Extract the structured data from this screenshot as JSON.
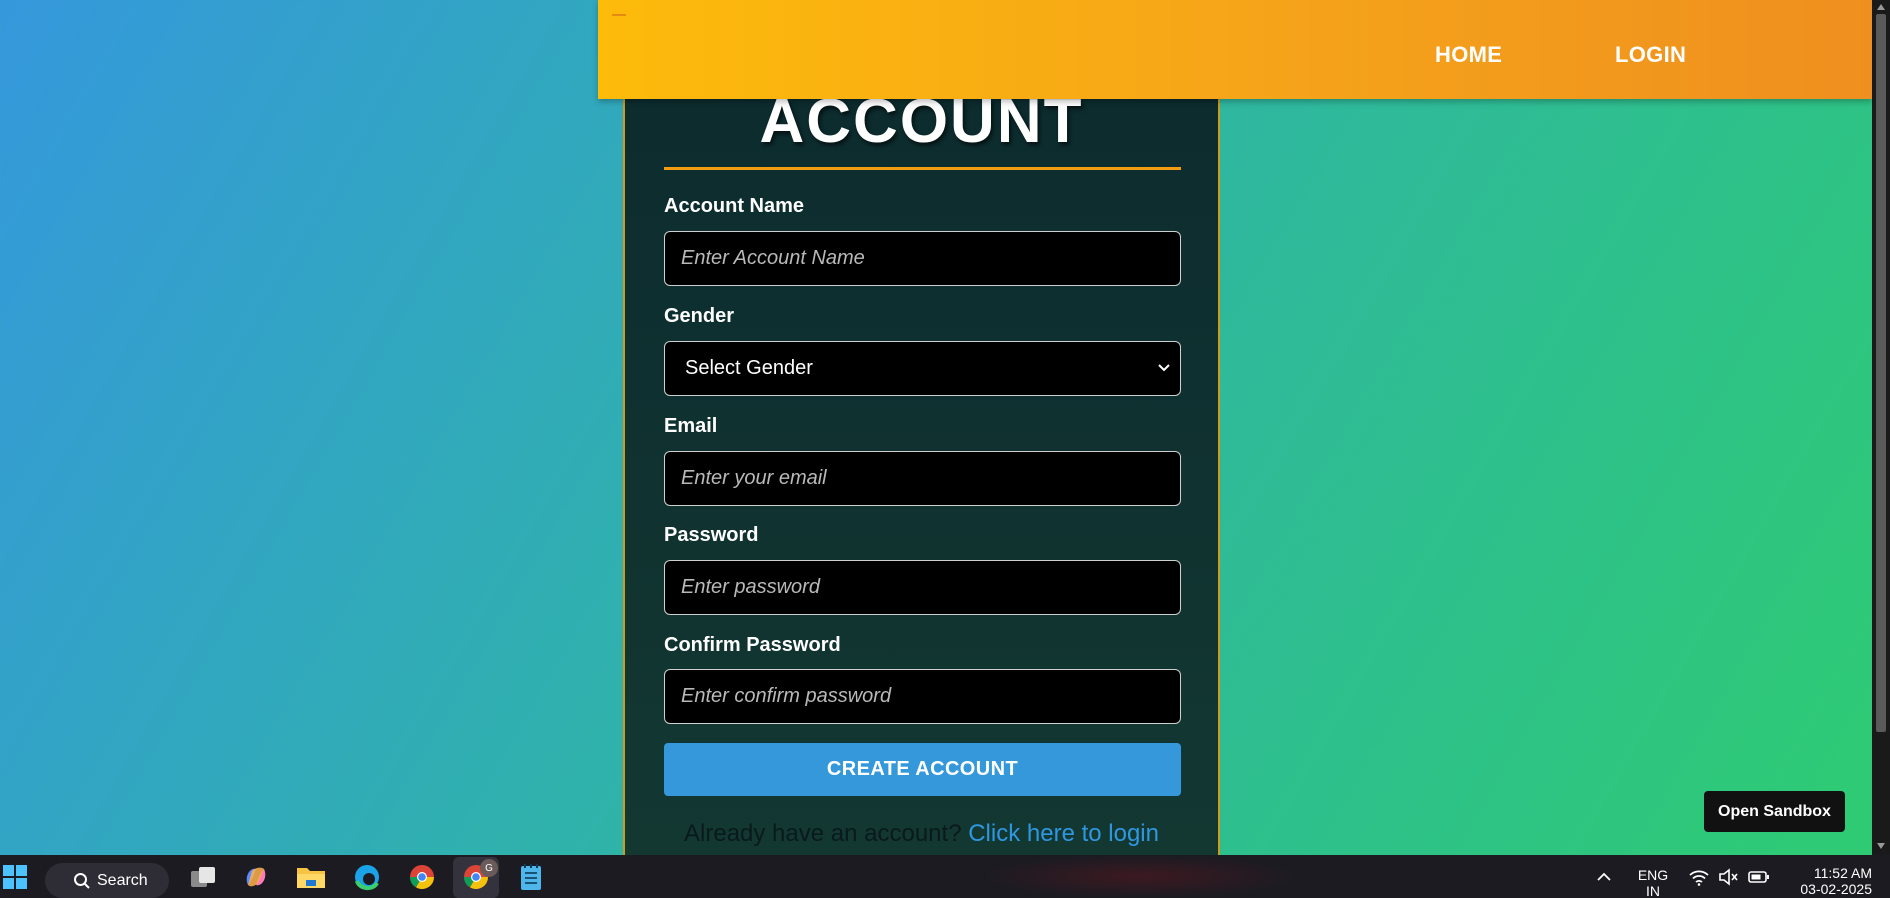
{
  "navbar": {
    "home_label": "HOME",
    "login_label": "LOGIN"
  },
  "form": {
    "title": "ACCOUNT",
    "account_name": {
      "label": "Account Name",
      "placeholder": "Enter Account Name",
      "value": ""
    },
    "gender": {
      "label": "Gender",
      "selected": "Select Gender"
    },
    "email": {
      "label": "Email",
      "placeholder": "Enter your email",
      "value": ""
    },
    "password": {
      "label": "Password",
      "placeholder": "Enter password",
      "value": ""
    },
    "confirm_password": {
      "label": "Confirm Password",
      "placeholder": "Enter confirm password",
      "value": ""
    },
    "submit_label": "CREATE ACCOUNT",
    "footer_text": "Already have an account?",
    "footer_link": "Click here to login"
  },
  "sandbox_button_label": "Open Sandbox",
  "taskbar": {
    "search_label": "Search",
    "chrome_badge": "G",
    "language_line1": "ENG",
    "language_line2": "IN",
    "time": "11:52 AM",
    "date": "03-02-2025"
  },
  "colors": {
    "nav_gradient_start": "#fdbb0a",
    "nav_gradient_end": "#ef8f1f",
    "button_blue": "#3498db",
    "card_bg": "#0c2b2e",
    "accent_orange": "#f39c12",
    "link_blue": "#2f97e0"
  },
  "icons": [
    "windows-start-icon",
    "search-icon",
    "task-view-icon",
    "copilot-icon",
    "file-explorer-icon",
    "edge-icon",
    "chrome-icon",
    "chrome-profile-icon",
    "notepad-icon",
    "chevron-up-icon",
    "wifi-icon",
    "speaker-muted-icon",
    "battery-icon",
    "chevron-down-icon"
  ]
}
